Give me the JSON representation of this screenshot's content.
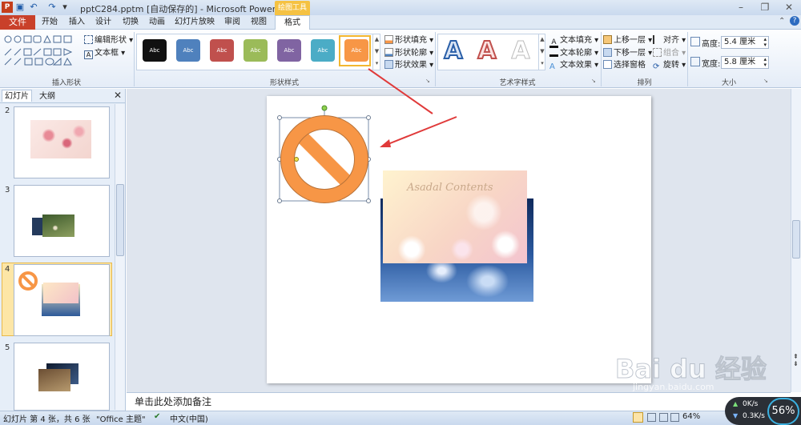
{
  "app": {
    "title": "pptC284.pptm [自动保存的]  -  Microsoft PowerPoint",
    "context_tools": "绘图工具"
  },
  "tabs": {
    "file": "文件",
    "items": [
      "开始",
      "插入",
      "设计",
      "切换",
      "动画",
      "幻灯片放映",
      "审阅",
      "视图"
    ],
    "active": "格式"
  },
  "ribbon": {
    "insert_shapes": {
      "edit_shape": "编辑形状",
      "text_box": "文本框",
      "label": "插入形状"
    },
    "shape_styles": {
      "swatch_text": "Abc",
      "swatch_colors": [
        "#111111",
        "#4f81bd",
        "#c0504d",
        "#9bbb59",
        "#8064a2",
        "#4bacc6",
        "#f79646"
      ],
      "fill": "形状填充",
      "outline": "形状轮廓",
      "effect": "形状效果",
      "label": "形状样式"
    },
    "wordart": {
      "letter": "A",
      "text_fill": "文本填充",
      "text_outline": "文本轮廓",
      "text_effect": "文本效果",
      "label": "艺术字样式"
    },
    "arrange": {
      "bring_forward": "上移一层",
      "send_backward": "下移一层",
      "selection_pane": "选择窗格",
      "align": "对齐",
      "group": "组合",
      "rotate": "旋转",
      "label": "排列"
    },
    "size": {
      "height_label": "高度:",
      "height_value": "5.4 厘米",
      "width_label": "宽度:",
      "width_value": "5.8 厘米",
      "label": "大小"
    }
  },
  "left_panel": {
    "tab_slides": "幻灯片",
    "tab_outline": "大纲",
    "slide_numbers": [
      "2",
      "3",
      "4",
      "5"
    ],
    "selected": "4"
  },
  "slide": {
    "picture_text": "Asadal Contents"
  },
  "notes_placeholder": "单击此处添加备注",
  "status": {
    "slide_info": "幻灯片 第 4 张，共 6 张",
    "theme": "\"Office 主题\"",
    "language": "中文(中国)",
    "zoom": "64%"
  },
  "net": {
    "up": "0K/s",
    "down": "0.3K/s",
    "percent": "56%"
  },
  "watermark": {
    "brand": "Bai du 经验",
    "url": "jingyan.baidu.com"
  }
}
